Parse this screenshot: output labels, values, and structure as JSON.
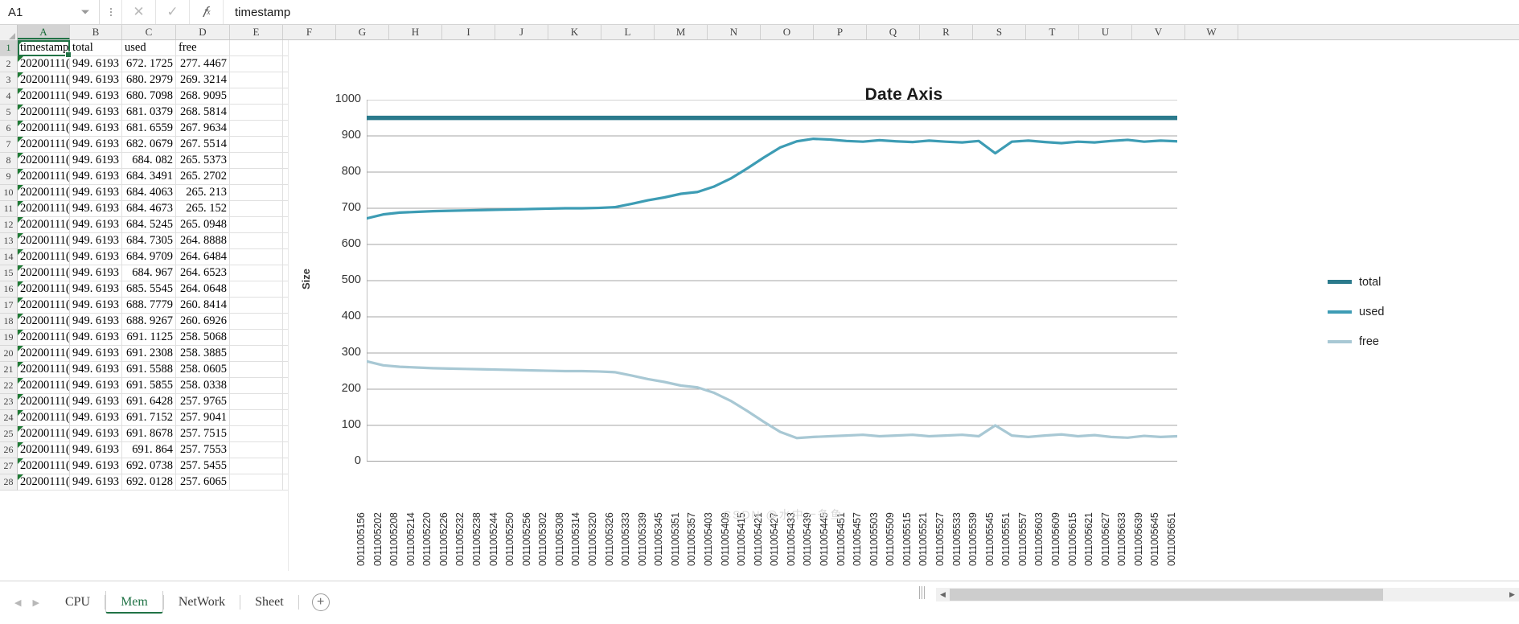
{
  "formula_bar": {
    "name_box_value": "A1",
    "formula_value": "timestamp",
    "cancel_icon": "close-icon",
    "confirm_icon": "check-icon",
    "function_icon": "fx-icon",
    "kebab_icon": "more-options-icon",
    "caret_icon": "chevron-down-icon"
  },
  "grid": {
    "columns": [
      "A",
      "B",
      "C",
      "D",
      "E",
      "F",
      "G",
      "H",
      "I",
      "J",
      "K",
      "L",
      "M",
      "N",
      "O",
      "P",
      "Q",
      "R",
      "S",
      "T",
      "U",
      "V",
      "W"
    ],
    "selected_column": "A",
    "selected_row": 1,
    "headers": [
      "timestamp",
      "total",
      "used",
      "free"
    ],
    "rows": [
      {
        "n": 1,
        "a": "timestamp",
        "b": "total",
        "c": "used",
        "d": "free",
        "is_header": true
      },
      {
        "n": 2,
        "a": "20200111(",
        "b": "949. 6193",
        "c": "672. 1725",
        "d": "277. 4467"
      },
      {
        "n": 3,
        "a": "20200111(",
        "b": "949. 6193",
        "c": "680. 2979",
        "d": "269. 3214"
      },
      {
        "n": 4,
        "a": "20200111(",
        "b": "949. 6193",
        "c": "680. 7098",
        "d": "268. 9095"
      },
      {
        "n": 5,
        "a": "20200111(",
        "b": "949. 6193",
        "c": "681. 0379",
        "d": "268. 5814"
      },
      {
        "n": 6,
        "a": "20200111(",
        "b": "949. 6193",
        "c": "681. 6559",
        "d": "267. 9634"
      },
      {
        "n": 7,
        "a": "20200111(",
        "b": "949. 6193",
        "c": "682. 0679",
        "d": "267. 5514"
      },
      {
        "n": 8,
        "a": "20200111(",
        "b": "949. 6193",
        "c": "684. 082",
        "d": "265. 5373"
      },
      {
        "n": 9,
        "a": "20200111(",
        "b": "949. 6193",
        "c": "684. 3491",
        "d": "265. 2702"
      },
      {
        "n": 10,
        "a": "20200111(",
        "b": "949. 6193",
        "c": "684. 4063",
        "d": "265. 213"
      },
      {
        "n": 11,
        "a": "20200111(",
        "b": "949. 6193",
        "c": "684. 4673",
        "d": "265. 152"
      },
      {
        "n": 12,
        "a": "20200111(",
        "b": "949. 6193",
        "c": "684. 5245",
        "d": "265. 0948"
      },
      {
        "n": 13,
        "a": "20200111(",
        "b": "949. 6193",
        "c": "684. 7305",
        "d": "264. 8888"
      },
      {
        "n": 14,
        "a": "20200111(",
        "b": "949. 6193",
        "c": "684. 9709",
        "d": "264. 6484"
      },
      {
        "n": 15,
        "a": "20200111(",
        "b": "949. 6193",
        "c": "684. 967",
        "d": "264. 6523"
      },
      {
        "n": 16,
        "a": "20200111(",
        "b": "949. 6193",
        "c": "685. 5545",
        "d": "264. 0648"
      },
      {
        "n": 17,
        "a": "20200111(",
        "b": "949. 6193",
        "c": "688. 7779",
        "d": "260. 8414"
      },
      {
        "n": 18,
        "a": "20200111(",
        "b": "949. 6193",
        "c": "688. 9267",
        "d": "260. 6926"
      },
      {
        "n": 19,
        "a": "20200111(",
        "b": "949. 6193",
        "c": "691. 1125",
        "d": "258. 5068"
      },
      {
        "n": 20,
        "a": "20200111(",
        "b": "949. 6193",
        "c": "691. 2308",
        "d": "258. 3885"
      },
      {
        "n": 21,
        "a": "20200111(",
        "b": "949. 6193",
        "c": "691. 5588",
        "d": "258. 0605"
      },
      {
        "n": 22,
        "a": "20200111(",
        "b": "949. 6193",
        "c": "691. 5855",
        "d": "258. 0338"
      },
      {
        "n": 23,
        "a": "20200111(",
        "b": "949. 6193",
        "c": "691. 6428",
        "d": "257. 9765"
      },
      {
        "n": 24,
        "a": "20200111(",
        "b": "949. 6193",
        "c": "691. 7152",
        "d": "257. 9041"
      },
      {
        "n": 25,
        "a": "20200111(",
        "b": "949. 6193",
        "c": "691. 8678",
        "d": "257. 7515"
      },
      {
        "n": 26,
        "a": "20200111(",
        "b": "949. 6193",
        "c": "691. 864",
        "d": "257. 7553"
      },
      {
        "n": 27,
        "a": "20200111(",
        "b": "949. 6193",
        "c": "692. 0738",
        "d": "257. 5455"
      },
      {
        "n": 28,
        "a": "20200111(",
        "b": "949. 6193",
        "c": "692. 0128",
        "d": "257. 6065"
      }
    ]
  },
  "chart_data": {
    "type": "line",
    "title": "Date Axis",
    "xlabel": "",
    "ylabel": "Size",
    "ylim": [
      0,
      1000
    ],
    "y_ticks": [
      1000,
      900,
      800,
      700,
      600,
      500,
      400,
      300,
      200,
      100,
      0
    ],
    "grid": true,
    "legend_position": "right",
    "colors": {
      "total": "#2b7a8c",
      "used": "#3d9cb4",
      "free": "#a8c8d4"
    },
    "categories": [
      "0011005156",
      "0011005202",
      "0011005208",
      "0011005214",
      "0011005220",
      "0011005226",
      "0011005232",
      "0011005238",
      "0011005244",
      "0011005250",
      "0011005256",
      "0011005302",
      "0011005308",
      "0011005314",
      "0011005320",
      "0011005326",
      "0011005333",
      "0011005339",
      "0011005345",
      "0011005351",
      "0011005357",
      "0011005403",
      "0011005409",
      "0011005415",
      "0011005421",
      "0011005427",
      "0011005433",
      "0011005439",
      "0011005445",
      "0011005451",
      "0011005457",
      "0011005503",
      "0011005509",
      "0011005515",
      "0011005521",
      "0011005527",
      "0011005533",
      "0011005539",
      "0011005545",
      "0011005551",
      "0011005557",
      "0011005603",
      "0011005609",
      "0011005615",
      "0011005621",
      "0011005627",
      "0011005633",
      "0011005639",
      "0011005645",
      "0011005651"
    ],
    "series": [
      {
        "name": "total",
        "values": [
          949.6,
          949.6,
          949.6,
          949.6,
          949.6,
          949.6,
          949.6,
          949.6,
          949.6,
          949.6,
          949.6,
          949.6,
          949.6,
          949.6,
          949.6,
          949.6,
          949.6,
          949.6,
          949.6,
          949.6,
          949.6,
          949.6,
          949.6,
          949.6,
          949.6,
          949.6,
          949.6,
          949.6,
          949.6,
          949.6,
          949.6,
          949.6,
          949.6,
          949.6,
          949.6,
          949.6,
          949.6,
          949.6,
          949.6,
          949.6,
          949.6,
          949.6,
          949.6,
          949.6,
          949.6,
          949.6,
          949.6,
          949.6,
          949.6,
          949.6
        ]
      },
      {
        "name": "used",
        "values": [
          672,
          683,
          688,
          690,
          692,
          693,
          694,
          695,
          696,
          697,
          698,
          699,
          700,
          700,
          701,
          703,
          712,
          722,
          730,
          740,
          745,
          760,
          782,
          810,
          840,
          868,
          885,
          892,
          890,
          886,
          884,
          888,
          885,
          883,
          887,
          884,
          882,
          886,
          852,
          884,
          887,
          883,
          880,
          884,
          882,
          886,
          889,
          884,
          887,
          885
        ]
      },
      {
        "name": "free",
        "values": [
          277,
          266,
          262,
          260,
          258,
          257,
          256,
          255,
          254,
          253,
          252,
          251,
          250,
          250,
          249,
          247,
          238,
          228,
          220,
          210,
          205,
          190,
          168,
          140,
          110,
          82,
          65,
          68,
          70,
          72,
          74,
          70,
          72,
          74,
          70,
          72,
          74,
          70,
          100,
          72,
          68,
          72,
          75,
          70,
          73,
          68,
          66,
          71,
          68,
          70
        ]
      }
    ]
  },
  "legend": {
    "items": [
      {
        "label": "total",
        "color": "#2b7a8c"
      },
      {
        "label": "used",
        "color": "#3d9cb4"
      },
      {
        "label": "free",
        "color": "#a8c8d4"
      }
    ]
  },
  "watermark": "CSDN @水中一条鱼",
  "sheet_tabs": {
    "tabs": [
      {
        "label": "CPU",
        "active": false
      },
      {
        "label": "Mem",
        "active": true
      },
      {
        "label": "NetWork",
        "active": false
      },
      {
        "label": "Sheet",
        "active": false
      }
    ],
    "add_label": "+",
    "nav_first": "◀",
    "nav_last": "▶"
  },
  "scrollbar": {
    "left_arrow": "◀",
    "right_arrow": "▶"
  }
}
